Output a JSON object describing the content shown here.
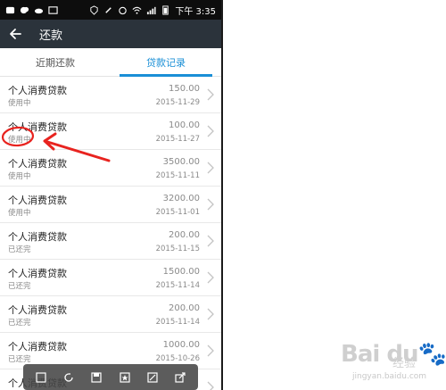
{
  "status_bar": {
    "time": "下午 3:35"
  },
  "header": {
    "title": "还款"
  },
  "tabs": [
    {
      "label": "近期还款",
      "active": false
    },
    {
      "label": "贷款记录",
      "active": true
    }
  ],
  "loans": [
    {
      "name": "个人消费贷款",
      "status": "使用中",
      "amount": "150.00",
      "date": "2015-11-29"
    },
    {
      "name": "个人消费贷款",
      "status": "使用中",
      "amount": "100.00",
      "date": "2015-11-27"
    },
    {
      "name": "个人消费贷款",
      "status": "使用中",
      "amount": "3500.00",
      "date": "2015-11-11"
    },
    {
      "name": "个人消费贷款",
      "status": "使用中",
      "amount": "3200.00",
      "date": "2015-11-01"
    },
    {
      "name": "个人消费贷款",
      "status": "已还完",
      "amount": "200.00",
      "date": "2015-11-15"
    },
    {
      "name": "个人消费贷款",
      "status": "已还完",
      "amount": "1500.00",
      "date": "2015-11-14"
    },
    {
      "name": "个人消费贷款",
      "status": "已还完",
      "amount": "200.00",
      "date": "2015-11-14"
    },
    {
      "name": "个人消费贷款",
      "status": "已还完",
      "amount": "1000.00",
      "date": "2015-10-26"
    },
    {
      "name": "个人消费贷款",
      "status": "",
      "amount": "",
      "date": ""
    }
  ],
  "watermark": {
    "logo": "Bai du",
    "text": "经验",
    "url": "jingyan.baidu.com"
  },
  "colors": {
    "accent": "#1a8fd6",
    "appbar": "#2b333b",
    "statusbar": "#0d0d0d",
    "annotation": "#e8231f"
  }
}
